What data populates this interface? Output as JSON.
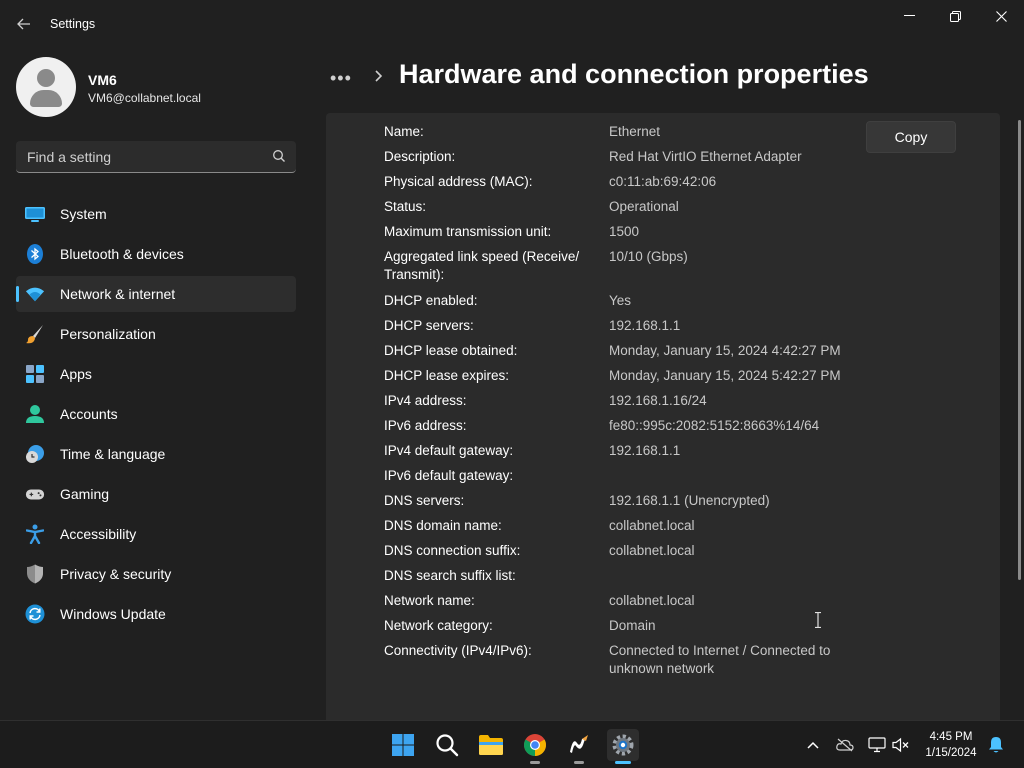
{
  "window": {
    "title": "Settings",
    "back_icon": "arrow-left-icon",
    "minimize_icon": "minimize-icon",
    "maximize_icon": "restore-icon",
    "close_icon": "close-icon"
  },
  "user": {
    "name": "VM6",
    "email": "VM6@collabnet.local"
  },
  "search": {
    "placeholder": "Find a setting",
    "value": ""
  },
  "sidebar": {
    "items": [
      {
        "label": "System",
        "icon": "monitor-icon",
        "active": false
      },
      {
        "label": "Bluetooth & devices",
        "icon": "bluetooth-icon",
        "active": false
      },
      {
        "label": "Network & internet",
        "icon": "wifi-icon",
        "active": true
      },
      {
        "label": "Personalization",
        "icon": "paintbrush-icon",
        "active": false
      },
      {
        "label": "Apps",
        "icon": "apps-icon",
        "active": false
      },
      {
        "label": "Accounts",
        "icon": "person-icon",
        "active": false
      },
      {
        "label": "Time & language",
        "icon": "globe-clock-icon",
        "active": false
      },
      {
        "label": "Gaming",
        "icon": "gamepad-icon",
        "active": false
      },
      {
        "label": "Accessibility",
        "icon": "accessibility-icon",
        "active": false
      },
      {
        "label": "Privacy & security",
        "icon": "shield-icon",
        "active": false
      },
      {
        "label": "Windows Update",
        "icon": "update-icon",
        "active": false
      }
    ]
  },
  "breadcrumb": {
    "more": "•••",
    "title": "Hardware and connection properties"
  },
  "copy_button": "Copy",
  "properties": [
    {
      "label": "Name:",
      "value": "Ethernet"
    },
    {
      "label": "Description:",
      "value": "Red Hat VirtIO Ethernet Adapter"
    },
    {
      "label": "Physical address (MAC):",
      "value": "c0:11:ab:69:42:06"
    },
    {
      "label": "Status:",
      "value": "Operational"
    },
    {
      "label": "Maximum transmission unit:",
      "value": "1500"
    },
    {
      "label": "Aggregated link speed (Receive/ Transmit):",
      "value": "10/10 (Gbps)"
    },
    {
      "label": "DHCP enabled:",
      "value": "Yes"
    },
    {
      "label": "DHCP servers:",
      "value": "192.168.1.1"
    },
    {
      "label": "DHCP lease obtained:",
      "value": "Monday, January 15, 2024 4:42:27 PM"
    },
    {
      "label": "DHCP lease expires:",
      "value": "Monday, January 15, 2024 5:42:27 PM"
    },
    {
      "label": "IPv4 address:",
      "value": "192.168.1.16/24"
    },
    {
      "label": "IPv6 address:",
      "value": "fe80::995c:2082:5152:8663%14/64"
    },
    {
      "label": "IPv4 default gateway:",
      "value": "192.168.1.1"
    },
    {
      "label": "IPv6 default gateway:",
      "value": ""
    },
    {
      "label": "DNS servers:",
      "value": "192.168.1.1 (Unencrypted)"
    },
    {
      "label": "DNS domain name:",
      "value": "collabnet.local"
    },
    {
      "label": "DNS connection suffix:",
      "value": "collabnet.local"
    },
    {
      "label": "DNS search suffix list:",
      "value": ""
    },
    {
      "label": "Network name:",
      "value": "collabnet.local"
    },
    {
      "label": "Network category:",
      "value": "Domain"
    },
    {
      "label": "Connectivity (IPv4/IPv6):",
      "value": "Connected to Internet / Connected to unknown network"
    }
  ],
  "taskbar": {
    "apps": [
      {
        "name": "start-icon"
      },
      {
        "name": "search-icon"
      },
      {
        "name": "file-explorer-icon"
      },
      {
        "name": "chrome-icon"
      },
      {
        "name": "inkscape-icon"
      },
      {
        "name": "settings-icon"
      }
    ],
    "tray": [
      "chevron-up-icon",
      "onedrive-icon",
      "network-icon",
      "volume-muted-icon"
    ],
    "time": "4:45 PM",
    "date": "1/15/2024",
    "notification_icon": "bell-icon"
  },
  "colors": {
    "accent": "#4cc2ff",
    "background": "#202020",
    "card": "#2b2b2b"
  }
}
